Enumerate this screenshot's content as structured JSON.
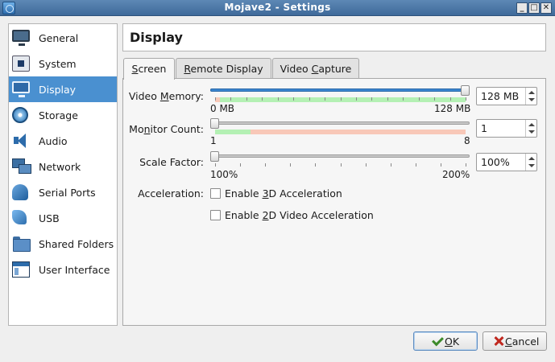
{
  "window": {
    "title": "Mojave2 - Settings",
    "min_glyph": "_",
    "max_glyph": "□",
    "close_glyph": "✕"
  },
  "sidebar": {
    "active_index": 2,
    "items": [
      {
        "label": "General",
        "icon": "monitor-icon"
      },
      {
        "label": "System",
        "icon": "chip-icon"
      },
      {
        "label": "Display",
        "icon": "monitor-icon"
      },
      {
        "label": "Storage",
        "icon": "disk-icon"
      },
      {
        "label": "Audio",
        "icon": "speaker-icon"
      },
      {
        "label": "Network",
        "icon": "network-icon"
      },
      {
        "label": "Serial Ports",
        "icon": "serial-port-icon"
      },
      {
        "label": "USB",
        "icon": "usb-icon"
      },
      {
        "label": "Shared Folders",
        "icon": "folder-icon"
      },
      {
        "label": "User Interface",
        "icon": "user-interface-icon"
      }
    ]
  },
  "page": {
    "title": "Display"
  },
  "tabs": [
    {
      "label_pre": "",
      "label_u": "S",
      "label_post": "creen"
    },
    {
      "label_pre": "",
      "label_u": "R",
      "label_post": "emote Display"
    },
    {
      "label_pre": "Video ",
      "label_u": "C",
      "label_post": "apture"
    }
  ],
  "screen": {
    "video_memory": {
      "label_pre": "Video ",
      "label_u": "M",
      "label_post": "emory:",
      "min_label": "0 MB",
      "max_label": "128 MB",
      "value_text": "128 MB",
      "value": 128,
      "min": 0,
      "max": 128
    },
    "monitor_count": {
      "label_pre": "Mo",
      "label_u": "n",
      "label_post": "itor Count:",
      "min_label": "1",
      "max_label": "8",
      "value_text": "1",
      "value": 1,
      "min": 1,
      "max": 8
    },
    "scale_factor": {
      "label": "Scale Factor:",
      "min_label": "100%",
      "max_label": "200%",
      "value_text": "100%",
      "value": 100,
      "min": 100,
      "max": 200
    },
    "acceleration": {
      "label": "Acceleration:",
      "enable_3d": {
        "pre": "Enable ",
        "u": "3",
        "post": "D Acceleration",
        "checked": false
      },
      "enable_2d": {
        "pre": "Enable ",
        "u": "2",
        "post": "D Video Acceleration",
        "checked": false
      }
    }
  },
  "buttons": {
    "ok": {
      "label_u": "O",
      "label_post": "K"
    },
    "cancel": {
      "label_u": "C",
      "label_post": "ancel"
    }
  },
  "colors": {
    "accent": "#4a90d0",
    "range_ok": "#b4f0b4",
    "range_warn": "#f8c8b8"
  }
}
